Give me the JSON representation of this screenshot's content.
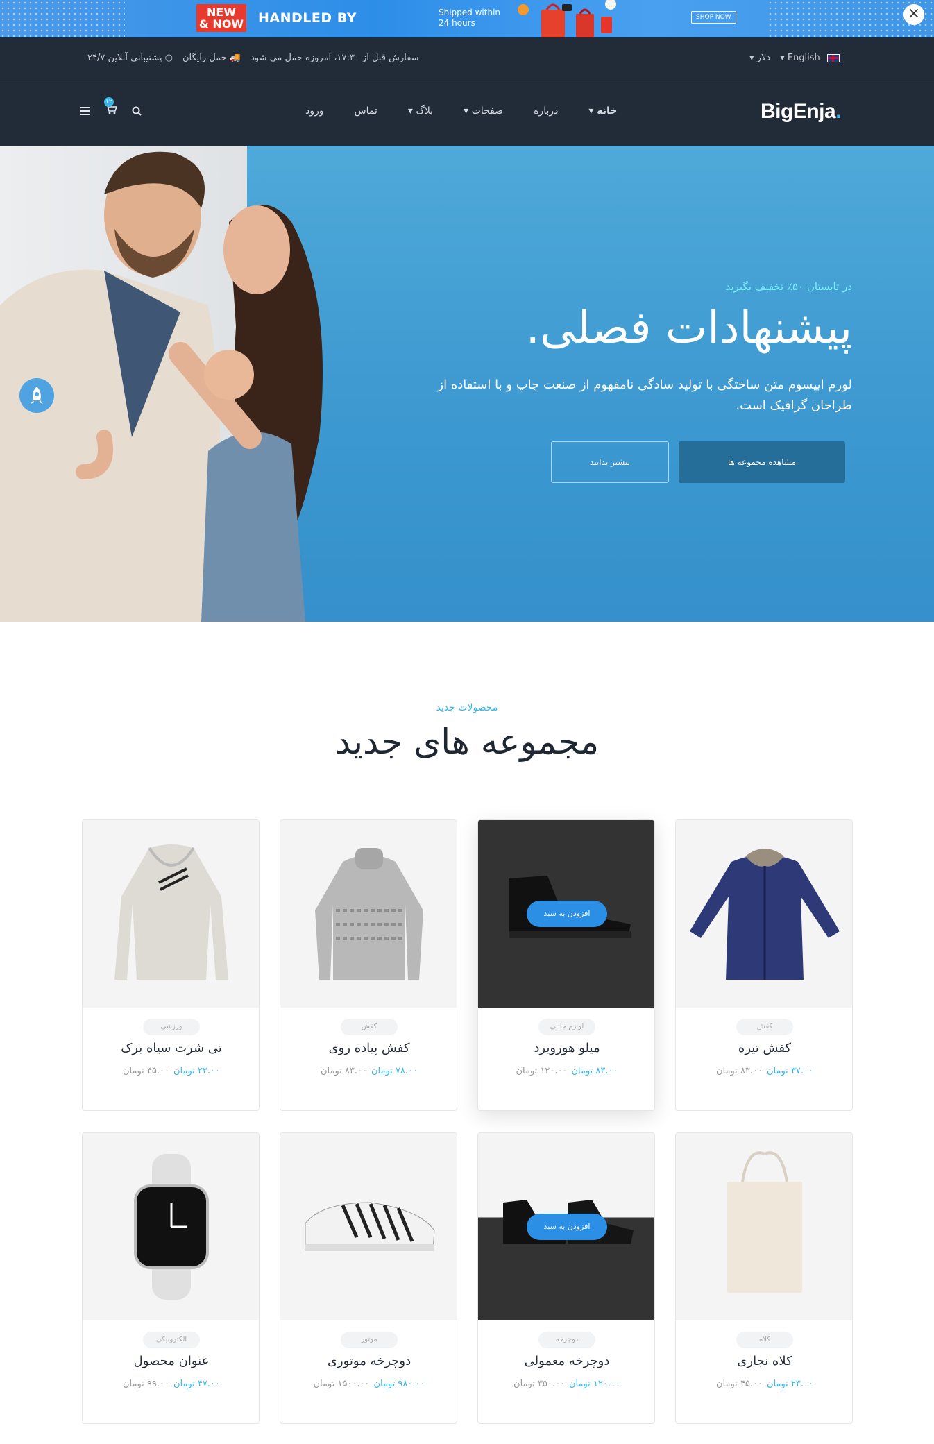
{
  "promo": {
    "badge_line1": "NEW",
    "badge_line2": "& NOW",
    "headline": "HANDLED BY",
    "shipped_line1": "Shipped within",
    "shipped_line2": "24 hours",
    "cta": "SHOP NOW",
    "close": "×"
  },
  "topbar": {
    "language": "English",
    "currency": "دلار",
    "order_notice": "سفارش قبل از ۱۷:۳۰، امروزه حمل می شود",
    "free_shipping": "حمل رایگان",
    "support": "۲۴/۷ پشتیبانی آنلاین"
  },
  "header": {
    "logo": "BigEnja",
    "logo_dot": ".",
    "nav": [
      "خانه",
      "درباره",
      "صفحات",
      "بلاگ",
      "تماس",
      "ورود"
    ],
    "cart_count": "۱۲"
  },
  "hero": {
    "kicker": "در تابستان ۵۰٪ تخفیف بگیرید",
    "title": "پیشنهادات فصلی.",
    "description": "لورم ایپسوم متن ساختگی با تولید سادگی نامفهوم از صنعت چاپ و با استفاده از طراحان گرافیک است.",
    "primary_button": "مشاهده مجموعه ها",
    "secondary_button": "بیشتر بدانید"
  },
  "section": {
    "kicker": "محصولات جدید",
    "title": "مجموعه های جدید"
  },
  "add_to_cart_label": "افزودن به سبد",
  "products": [
    {
      "category": "کفش",
      "name": "کفش تیره",
      "price": "۳۷.۰۰ تومان",
      "old_price": "۸۳.۰۰ تومان"
    },
    {
      "category": "لوازم جانبی",
      "name": "میلو هورویرد",
      "price": "۸۳.۰۰ تومان",
      "old_price": "۱۲۰.۰۰ تومان"
    },
    {
      "category": "کفش",
      "name": "کفش پیاده روی",
      "price": "۷۸.۰۰ تومان",
      "old_price": "۸۳.۰۰ تومان"
    },
    {
      "category": "ورزشی",
      "name": "تی شرت سیاه برک",
      "price": "۲۳.۰۰ تومان",
      "old_price": "۴۵.۰۰ تومان"
    },
    {
      "category": "کلاه",
      "name": "کلاه نجاری",
      "price": "۲۳.۰۰ تومان",
      "old_price": "۴۵.۰۰ تومان"
    },
    {
      "category": "دوچرخه",
      "name": "دوچرخه معمولی",
      "price": "۱۲۰.۰۰ تومان",
      "old_price": "۳۵۰.۰۰ تومان"
    },
    {
      "category": "موتور",
      "name": "دوچرخه موتوری",
      "price": "۹۸۰.۰۰ تومان",
      "old_price": "۱۵۰۰.۰۰ تومان"
    },
    {
      "category": "الکترونیکی",
      "name": "عنوان محصول",
      "price": "۴۷.۰۰ تومان",
      "old_price": "۹۹.۰۰ تومان"
    }
  ]
}
